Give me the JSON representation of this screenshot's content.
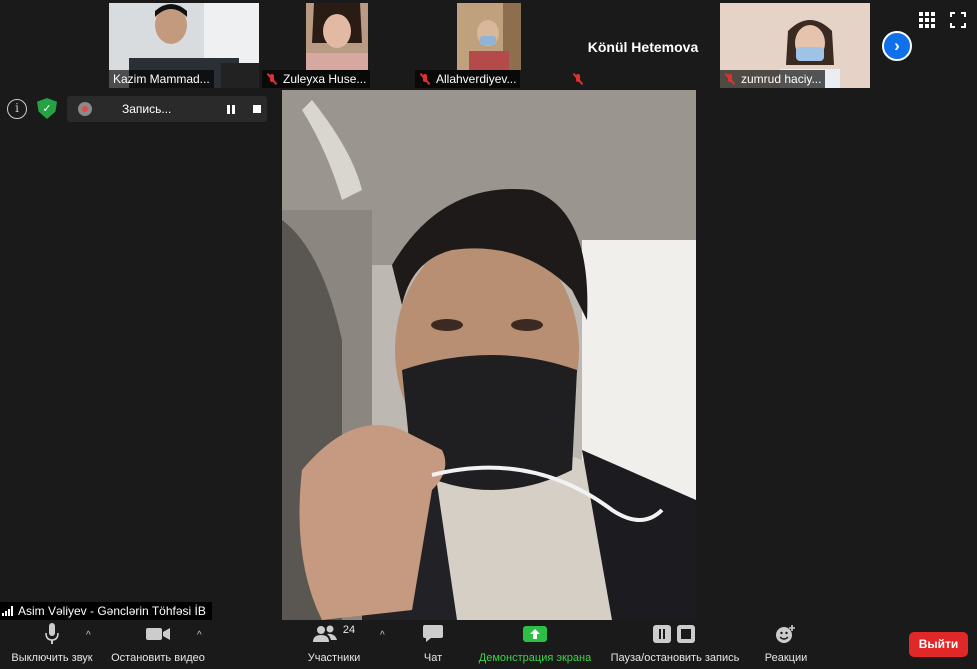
{
  "thumbnails": [
    {
      "name": "Kazim Mammad...",
      "muted": false
    },
    {
      "name": "Zuleyxa Huse...",
      "muted": true
    },
    {
      "name": "Allahverdiyev...",
      "muted": true
    },
    {
      "name": "",
      "display_name": "Könül Hetemova",
      "muted": true
    },
    {
      "name": "zumrud haciy...",
      "muted": true
    }
  ],
  "next_icon": "chevron-right-icon",
  "recording": {
    "label": "Запись..."
  },
  "main_video": {
    "speaker_name": "Asim Vəliyev - Gənclərin Töhfəsi İB"
  },
  "toolbar": {
    "mute_label": "Выключить звук",
    "video_label": "Остановить видео",
    "participants_label": "Участники",
    "participants_count": "24",
    "chat_label": "Чат",
    "share_label": "Демонстрация экрана",
    "record_label": "Пауза/остановить запись",
    "reactions_label": "Реакции",
    "exit_label": "Выйти"
  },
  "colors": {
    "share_green": "#3ad54b",
    "exit_red": "#e02828",
    "accent_blue": "#0e71eb"
  }
}
